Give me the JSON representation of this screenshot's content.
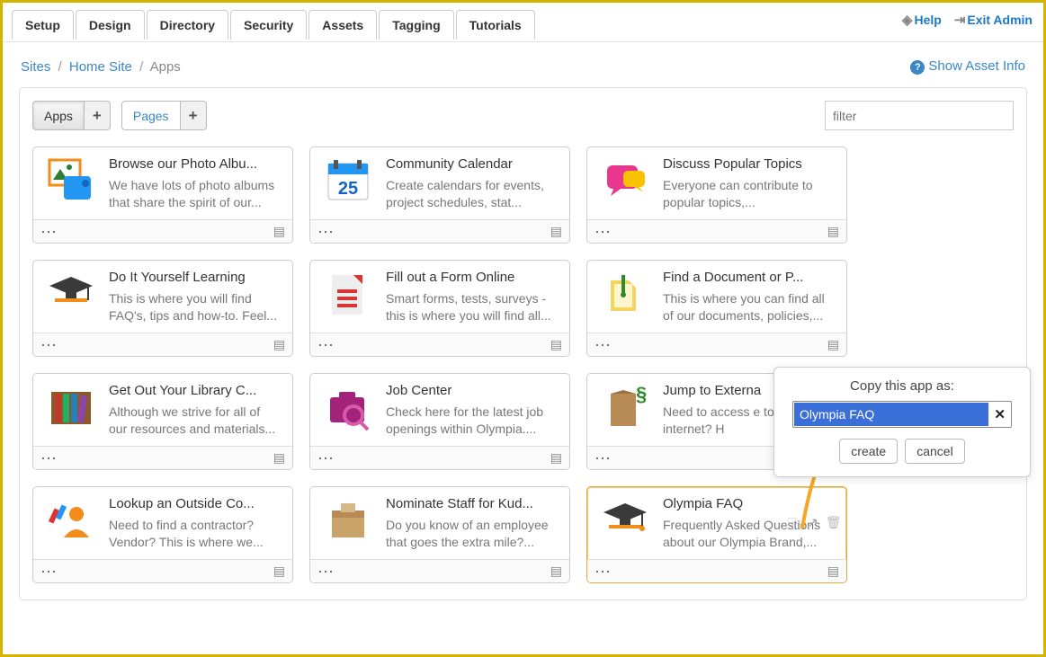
{
  "topTabs": [
    "Setup",
    "Design",
    "Directory",
    "Security",
    "Assets",
    "Tagging",
    "Tutorials"
  ],
  "topRight": {
    "help": "Help",
    "exit": "Exit Admin"
  },
  "breadcrumb": {
    "sites": "Sites",
    "home": "Home Site",
    "current": "Apps"
  },
  "assetInfo": "Show Asset Info",
  "segments": {
    "apps": "Apps",
    "pages": "Pages"
  },
  "filter": {
    "placeholder": "filter"
  },
  "popover": {
    "title": "Copy this app as:",
    "value": "Olympia FAQ",
    "create": "create",
    "cancel": "cancel"
  },
  "cards": [
    {
      "title": "Browse our Photo Albu...",
      "desc": "We have lots of photo albums that share the spirit of our..."
    },
    {
      "title": "Community Calendar",
      "desc": "Create calendars for events, project schedules, stat..."
    },
    {
      "title": "Discuss Popular Topics",
      "desc": "Everyone can contribute to popular topics,..."
    },
    {
      "title": "Do It Yourself Learning",
      "desc": "This is where you will find FAQ's, tips and how-to. Feel..."
    },
    {
      "title": "Fill out a Form Online",
      "desc": "Smart forms, tests, surveys - this is where you will find all..."
    },
    {
      "title": "Find a Document or P...",
      "desc": "This is where you can find all of our documents, policies,..."
    },
    {
      "title": "Get Out Your Library C...",
      "desc": "Although we strive for all of our resources and materials..."
    },
    {
      "title": "Job Center",
      "desc": "Check here for the latest job openings within Olympia...."
    },
    {
      "title": "Jump to Externa",
      "desc": "Need to access e           to the internet? H"
    },
    {
      "title": "Lookup an Outside Co...",
      "desc": "Need to find a contractor? Vendor? This is where we..."
    },
    {
      "title": "Nominate Staff for Kud...",
      "desc": "Do you know of an employee that goes the extra mile?..."
    },
    {
      "title": "Olympia FAQ",
      "desc": "Frequently Asked Questions about our Olympia Brand,..."
    }
  ]
}
